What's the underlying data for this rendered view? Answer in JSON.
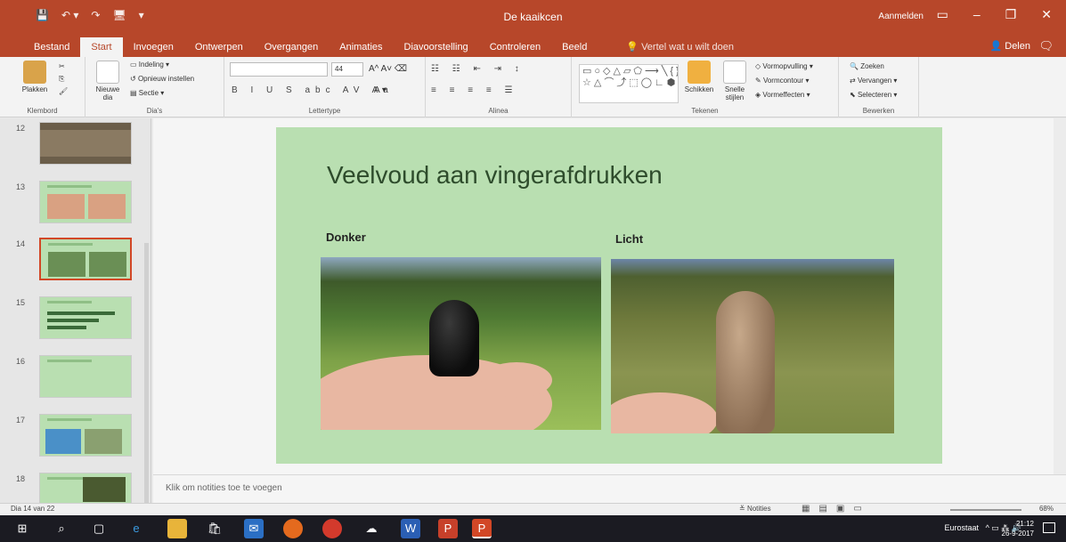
{
  "app": {
    "title": "De kaaikcen",
    "signin": "Aanmelden",
    "window_controls": [
      "▭",
      "–",
      "❐",
      "✕"
    ],
    "qat": [
      "💾",
      "↶ ▾",
      "↷",
      "🖥",
      "▾"
    ]
  },
  "tabs": [
    "Bestand",
    "Start",
    "Invoegen",
    "Ontwerpen",
    "Overgangen",
    "Animaties",
    "Diavoorstelling",
    "Controleren",
    "Beeld"
  ],
  "active_tab": "Start",
  "tellme": "Vertel wat u wilt doen",
  "share": "Delen",
  "ribbon": {
    "groups": [
      "Klembord",
      "Dia's",
      "Lettertype",
      "Alinea",
      "Tekenen",
      "Bewerken"
    ],
    "paste": "Plakken",
    "new_slide": "Nieuwe dia",
    "layout": "Indeling",
    "reset": "Opnieuw instellen",
    "section": "Sectie",
    "font_size": "44",
    "arrange": "Schikken",
    "quick_styles": "Snelle stijlen",
    "shape_fill": "Vormopvulling",
    "shape_outline": "Vormcontour",
    "shape_effects": "Vormeffecten",
    "find": "Zoeken",
    "replace": "Vervangen",
    "select": "Selecteren",
    "font_glyphs": "B I U S abc AV Aa",
    "para_glyphs": "≡ ≡ ≡ ≡ ☰"
  },
  "thumbnails": [
    {
      "num": "12"
    },
    {
      "num": "13"
    },
    {
      "num": "14",
      "selected": true
    },
    {
      "num": "15"
    },
    {
      "num": "16"
    },
    {
      "num": "17"
    },
    {
      "num": "18"
    }
  ],
  "slide": {
    "title": "Veelvoud aan vingerafdrukken",
    "left_label": "Donker",
    "right_label": "Licht"
  },
  "notes_placeholder": "Klik om notities toe te voegen",
  "status": {
    "slide_count": "Dia 14 van 22",
    "notes": "Notities",
    "zoom": "68%"
  },
  "taskbar": {
    "language": "Eurostaat",
    "time": "21:12",
    "date": "26-9-2017",
    "tray": "^ ▭ ⁂ 🔊"
  },
  "colors": {
    "accent": "#b7472a",
    "slide_bg": "#b9dfb1",
    "title_text": "#2e4c2c"
  }
}
